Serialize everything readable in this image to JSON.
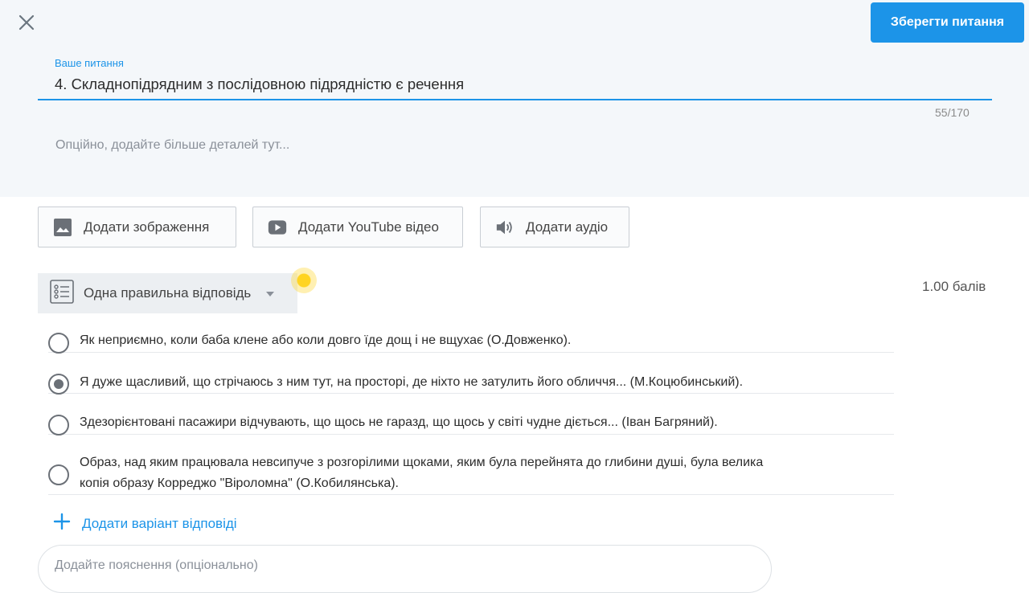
{
  "header": {
    "close_icon": "close-icon",
    "save_label": "Зберегти питання"
  },
  "question": {
    "label": "Ваше питання",
    "text": "4. Складнопідрядним з послідовною підрядністю є речення",
    "counter": "55/170",
    "details_placeholder": "Опційно, додайте більше деталей тут..."
  },
  "media": [
    {
      "label": "Додати зображення",
      "icon": "image-icon"
    },
    {
      "label": "Додати YouTube відео",
      "icon": "youtube-icon"
    },
    {
      "label": "Додати аудіо",
      "icon": "speaker-icon"
    }
  ],
  "question_type": {
    "label": "Одна правильна відповідь",
    "icon": "list-icon"
  },
  "points": "1.00 балів",
  "options": [
    {
      "text": "Як неприємно, коли баба клене або коли довго їде дощ і не вщухає (О.Довженко).",
      "selected": false
    },
    {
      "text": "Я дуже щасливий, що стрічаюсь з ним тут, на просторі, де ніхто не затулить його обличчя... (М.Коцюбинський).",
      "selected": true
    },
    {
      "text": "Здезорієнтовані пасажири відчувають, що щось не гаразд, що щось у світі чудне діється... (Іван Багряний).",
      "selected": false
    },
    {
      "text_line1": "Образ, над яким працювала невсипуче з розгорілими щоками, яким була перейнята до глибини душі, була велика",
      "text_line2": "копія образу Корреджо \"Віроломна\" (О.Кобилянська).",
      "selected": false
    }
  ],
  "add_option_label": "Додати варіант відповіді",
  "explanation_placeholder": "Додайте пояснення (опціонально)",
  "colors": {
    "accent": "#1c94e8",
    "highlight": "#ffd422"
  }
}
